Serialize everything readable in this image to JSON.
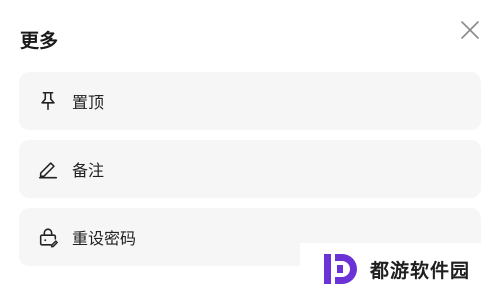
{
  "sheet": {
    "title": "更多",
    "close_icon": "close-icon"
  },
  "menu": {
    "items": [
      {
        "label": "置顶",
        "icon": "pin-icon"
      },
      {
        "label": "备注",
        "icon": "pen-icon"
      },
      {
        "label": "重设密码",
        "icon": "lock-reset-icon"
      }
    ]
  },
  "watermark": {
    "text": "都游软件园",
    "logo_color": "#6b33d6"
  }
}
